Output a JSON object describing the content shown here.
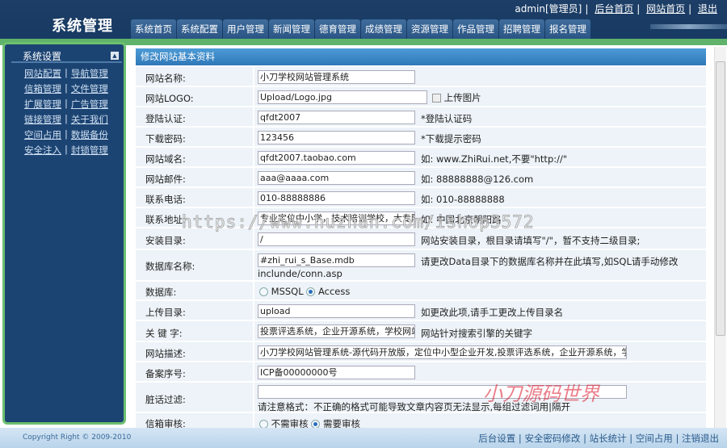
{
  "header": {
    "title": "系统管理",
    "user": "admin[管理员]",
    "links": [
      "后台首页",
      "网站首页",
      "退出"
    ]
  },
  "tabs": [
    "系统首页",
    "系统配置",
    "用户管理",
    "新闻管理",
    "德育管理",
    "成绩管理",
    "资源管理",
    "作品管理",
    "招聘管理",
    "报名管理"
  ],
  "sidebar": {
    "title": "系统设置",
    "toggle": "▲",
    "rows": [
      [
        "网站配置",
        "导航管理"
      ],
      [
        "信箱管理",
        "文件管理"
      ],
      [
        "扩展管理",
        "广告管理"
      ],
      [
        "链接管理",
        "关于我们"
      ],
      [
        "空间占用",
        "数据备份"
      ],
      [
        "安全注入",
        "封锁管理"
      ]
    ]
  },
  "panel": {
    "title": "修改网站基本资料"
  },
  "form": {
    "site_name": {
      "label": "网站名称:",
      "value": "小刀学校网站管理系统"
    },
    "logo": {
      "label": "网站LOGO:",
      "value": "Upload/Logo.jpg",
      "checkbox": "上传图片"
    },
    "login_code": {
      "label": "登陆认证:",
      "value": "qfdt2007",
      "hint": "*登陆认证码"
    },
    "download_pwd": {
      "label": "下载密码:",
      "value": "123456",
      "hint": "*下载提示密码"
    },
    "domain": {
      "label": "网站域名:",
      "value": "qfdt2007.taobao.com",
      "hint": "如: www.ZhiRui.net,不要\"http://\""
    },
    "email": {
      "label": "网站邮件:",
      "value": "aaa@aaaa.com",
      "hint": "如: 88888888@126.com"
    },
    "phone": {
      "label": "联系电话:",
      "value": "010-88888886",
      "hint": "如: 010-88888888"
    },
    "address": {
      "label": "联系地址:",
      "value": "专业定位中小学，技术培训学校，大专院校",
      "hint": "如: 中国北京朝阳路"
    },
    "install_dir": {
      "label": "安装目录:",
      "value": "/",
      "hint": "网站安装目录，根目录请填写\"/\"，暂不支持二级目录;"
    },
    "db_name": {
      "label": "数据库名称:",
      "value": "#zhi_rui_s_Base.mdb",
      "hint": "请更改Data目录下的数据库名称并在此填写,如SQL请手动修改",
      "hint2": "inclunde/conn.asp"
    },
    "db_type": {
      "label": "数据库:",
      "options": [
        "MSSQL",
        "Access"
      ],
      "selected": "Access"
    },
    "upload_dir": {
      "label": "上传目录:",
      "value": "upload",
      "hint": "如更改此项,请手工更改上传目录名"
    },
    "keywords": {
      "label": "关 键 字:",
      "value": "投票评选系统，企业开源系统，学校网站系统",
      "hint": "网站针对搜索引擎的关键字"
    },
    "description": {
      "label": "网站描述:",
      "value": "小刀学校网站管理系统-源代码开放版，定位中小型企业开发,投票评选系统，企业开源系统，学校网"
    },
    "icp": {
      "label": "备案序号:",
      "value": "ICP备00000000号"
    },
    "filter": {
      "label": "脏话过滤:",
      "value": "",
      "hint": "请注意格式：不正确的格式可能导致文章内容页无法显示,每组过滤词用|隔开"
    },
    "mail_audit": {
      "label": "信箱审核:",
      "options": [
        "不需审核",
        "需要审核"
      ],
      "selected": "需要审核"
    }
  },
  "footer": {
    "copyright": "Copyright Right © 2009-2010",
    "links": [
      "后台设置",
      "安全密码修改",
      "站长统计",
      "空间占用",
      "注销退出"
    ]
  },
  "watermarks": {
    "url": "https://www.huzhan.com/ishop3572",
    "brand": "小刀源码世界"
  }
}
